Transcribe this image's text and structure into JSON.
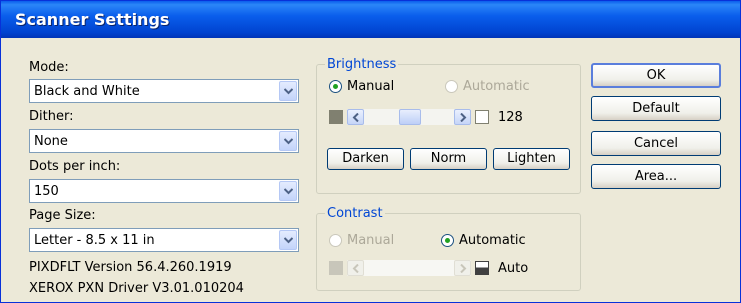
{
  "window": {
    "title": "Scanner Settings"
  },
  "left": {
    "mode_label": "Mode:",
    "mode_value": "Black and White",
    "dither_label": "Dither:",
    "dither_value": "None",
    "dpi_label": "Dots per inch:",
    "dpi_value": "150",
    "pagesize_label": "Page Size:",
    "pagesize_value": "Letter - 8.5 x 11 in",
    "version_line": "PIXDFLT Version 56.4.260.1919",
    "driver_line": "XEROX PXN Driver V3.01.010204"
  },
  "brightness": {
    "title": "Brightness",
    "manual_label": "Manual",
    "automatic_label": "Automatic",
    "mode_selected": "Manual",
    "value": "128",
    "darken_label": "Darken",
    "norm_label": "Norm",
    "lighten_label": "Lighten"
  },
  "contrast": {
    "title": "Contrast",
    "manual_label": "Manual",
    "automatic_label": "Automatic",
    "mode_selected": "Automatic",
    "value": "Auto"
  },
  "buttons": {
    "ok": "OK",
    "default": "Default",
    "cancel": "Cancel",
    "area": "Area..."
  },
  "colors": {
    "title_bar": "#0A5EEC",
    "face": "#ECE9D8",
    "group_title": "#0046D5",
    "radio_dot": "#21A121"
  }
}
